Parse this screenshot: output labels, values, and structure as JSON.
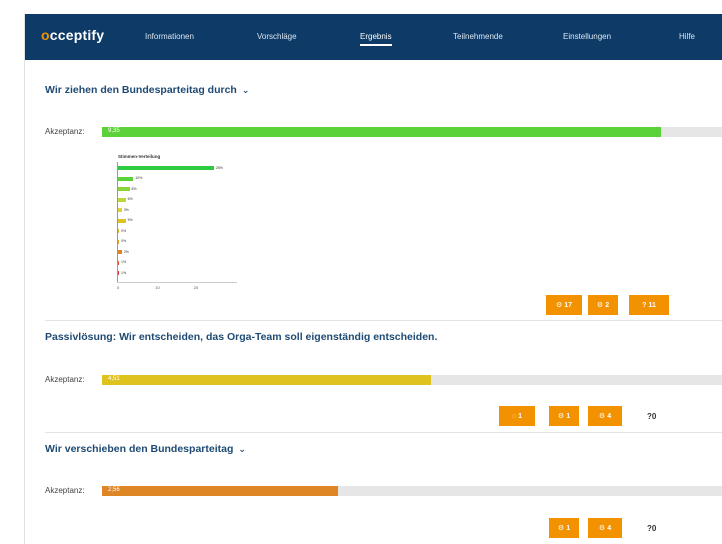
{
  "app": {
    "logo_first": "o",
    "logo_rest": "cceptify",
    "nav": [
      {
        "label": "Informationen",
        "active": false
      },
      {
        "label": "Vorschläge",
        "active": false
      },
      {
        "label": "Ergebnis",
        "active": true
      },
      {
        "label": "Teilnehmende",
        "active": false
      },
      {
        "label": "Einstellungen",
        "active": false
      },
      {
        "label": "Hilfe",
        "active": false
      }
    ]
  },
  "colors": {
    "nav_bg": "#0d3a66",
    "accent": "#f29200",
    "green": "#5cd23a",
    "yellow": "#e0c21f",
    "orange": "#de8526"
  },
  "proposals": [
    {
      "title": "Wir ziehen den Bundesparteitag durch",
      "has_chevron": true,
      "accept_label": "Akzeptanz:",
      "fill_text": "9,35",
      "fill_fraction": 0.9,
      "fill_color": "#5cd23a",
      "buttons": [
        {
          "icon": "gear-icon",
          "label": "17"
        },
        {
          "icon": "gear-icon",
          "label": "2"
        },
        {
          "icon": "question-icon",
          "label": "11"
        }
      ],
      "question_count": ""
    },
    {
      "title": "Passivlösung: Wir entscheiden, das Orga-Team soll eigenständig entscheiden.",
      "has_chevron": false,
      "accept_label": "Akzeptanz:",
      "fill_text": "4,51",
      "fill_fraction": 0.53,
      "fill_color": "#e0c21f",
      "buttons": [
        {
          "icon": "comment-icon",
          "label": "1"
        },
        {
          "icon": "gear-icon",
          "label": "1"
        },
        {
          "icon": "gear-icon",
          "label": "4"
        }
      ],
      "question_count": "0"
    },
    {
      "title": "Wir verschieben den Bundesparteitag",
      "has_chevron": true,
      "accept_label": "Akzeptanz:",
      "fill_text": "2,56",
      "fill_fraction": 0.38,
      "fill_color": "#de8526",
      "buttons": [
        {
          "icon": "gear-icon",
          "label": "1"
        },
        {
          "icon": "gear-icon",
          "label": "4"
        }
      ],
      "question_count": "0"
    }
  ],
  "chart_data": {
    "type": "bar",
    "title": "Stimmen-Verteilung",
    "orientation": "horizontal",
    "categories": [
      "0",
      "1",
      "2",
      "3",
      "4",
      "5",
      "6",
      "7",
      "8",
      "9",
      "10"
    ],
    "values": [
      25,
      4,
      3,
      2,
      1,
      2,
      0,
      0,
      1,
      0,
      0
    ],
    "labels": [
      "25%",
      "10%",
      "8%",
      "6%",
      "3%",
      "5%",
      "0%",
      "0%",
      "2%",
      "1%",
      "1%"
    ],
    "colors": [
      "#2ecc40",
      "#5cd23a",
      "#8ad63a",
      "#b9d93a",
      "#e0d23a",
      "#e0c21f",
      "#e0b030",
      "#e09a30",
      "#de8526",
      "#d95a2a",
      "#d63a3a"
    ],
    "xlim": [
      0,
      30
    ],
    "xticks": [
      "0",
      "10",
      "20"
    ]
  }
}
